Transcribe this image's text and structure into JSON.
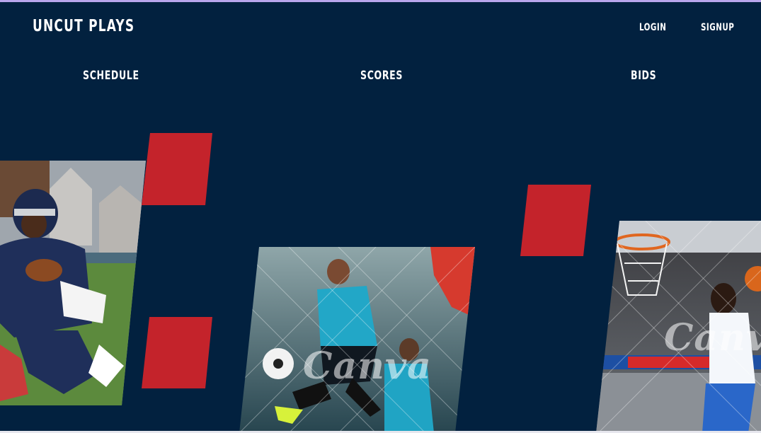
{
  "header": {
    "brand": "UNCUT PLAYS",
    "login_label": "LOGIN",
    "signup_label": "SIGNUP"
  },
  "nav": {
    "items": [
      {
        "label": "SCHEDULE"
      },
      {
        "label": "SCORES"
      },
      {
        "label": "BIDS"
      }
    ]
  },
  "gallery": {
    "images": [
      {
        "subject": "American football player running with ball",
        "icon": "football-photo"
      },
      {
        "subject": "Soccer players competing for ball",
        "icon": "soccer-photo",
        "watermark": "Canva"
      },
      {
        "subject": "Basketball player shooting at hoop",
        "icon": "basketball-photo",
        "watermark": "Canva"
      }
    ]
  },
  "colors": {
    "background": "#02213f",
    "accent_red": "#c4232b",
    "text": "#ffffff"
  }
}
